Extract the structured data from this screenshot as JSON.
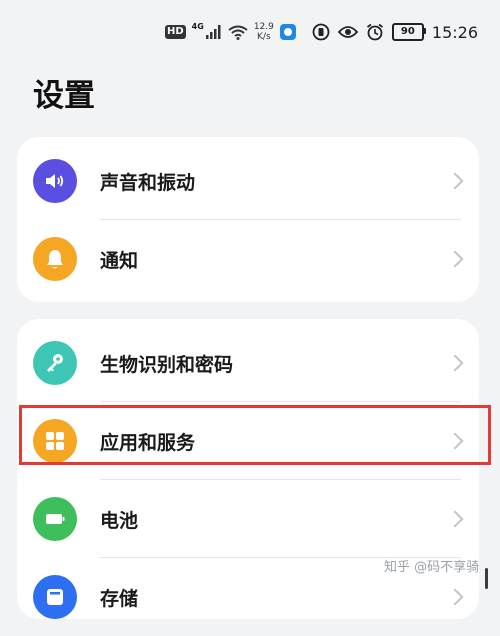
{
  "status_bar": {
    "hd": "HD",
    "network": "4G",
    "speed_value": "12.9",
    "speed_unit": "K/s",
    "battery": "90",
    "time": "15:26"
  },
  "page": {
    "title": "设置"
  },
  "groups": [
    {
      "items": [
        {
          "label": "声音和振动",
          "icon": "speaker-icon",
          "icon_color": "#5a4fe0"
        },
        {
          "label": "通知",
          "icon": "bell-icon",
          "icon_color": "#f5a623"
        }
      ]
    },
    {
      "items": [
        {
          "label": "生物识别和密码",
          "icon": "key-icon",
          "icon_color": "#3cc6b3"
        },
        {
          "label": "应用和服务",
          "icon": "apps-grid-icon",
          "icon_color": "#f5a623",
          "highlighted": true,
          "highlight_color": "#e53935"
        },
        {
          "label": "电池",
          "icon": "battery-icon",
          "icon_color": "#3fbf5c"
        },
        {
          "label": "存储",
          "icon": "storage-icon",
          "icon_color": "#2d6ff0"
        }
      ]
    }
  ],
  "watermark": "知乎 @码不享骑"
}
